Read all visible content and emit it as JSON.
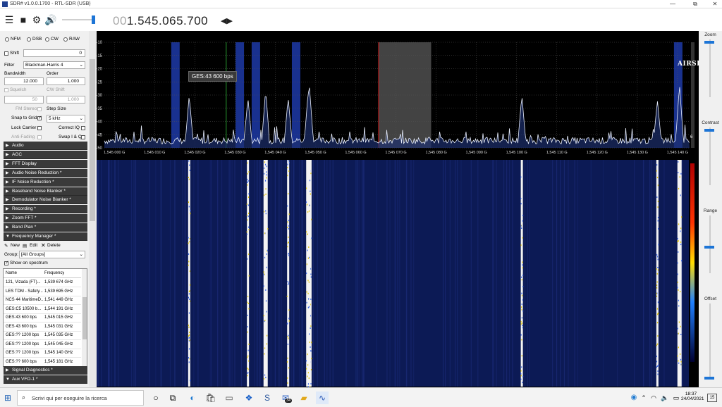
{
  "window": {
    "title": "SDR# v1.0.0.1700 - RTL-SDR (USB)",
    "buttons": [
      "—",
      "⧉",
      "✕"
    ]
  },
  "toolbar": {
    "frequency_dim": "00",
    "frequency": "1.545.065.700",
    "arrows": "◀▶",
    "logo": "AIRSPY"
  },
  "radio": {
    "modes": [
      "NFM",
      "DSB",
      "CW",
      "RAW"
    ],
    "shift_label": "Shift",
    "shift_value": "0",
    "filter_label": "Filter",
    "filter_value": "Blackman-Harris 4",
    "bandwidth_label": "Bandwidth",
    "bandwidth_value": "12.000",
    "order_label": "Order",
    "order_value": "1.000",
    "squelch_label": "Squelch",
    "squelch_value": "50",
    "cwshift_label": "CW Shift",
    "cwshift_value": "1.000",
    "fmstereo_label": "FM Stereo",
    "stepsize_label": "Step Size",
    "snap_label": "Snap to Grid",
    "step_value": "5 kHz",
    "lockcarrier_label": "Lock Carrier",
    "correctiq_label": "Correct IQ",
    "antifading_label": "Anti-Fading",
    "swapiq_label": "Swap I & Q"
  },
  "sections_top": [
    {
      "label": "Audio",
      "arrow": "▶"
    },
    {
      "label": "AGC",
      "arrow": "▶"
    },
    {
      "label": "FFT Display",
      "arrow": "▶"
    },
    {
      "label": "Audio Noise Reduction *",
      "arrow": "▶"
    },
    {
      "label": "IF Noise Reduction *",
      "arrow": "▶"
    },
    {
      "label": "Baseband Noise Blanker *",
      "arrow": "▶"
    },
    {
      "label": "Demodulator Noise Blanker *",
      "arrow": "▶"
    },
    {
      "label": "Recording *",
      "arrow": "▶"
    },
    {
      "label": "Zoom FFT *",
      "arrow": "▶"
    },
    {
      "label": "Band Plan *",
      "arrow": "▶"
    },
    {
      "label": "Frequency Manager *",
      "arrow": "▼"
    }
  ],
  "freqmanager": {
    "new_label": "New",
    "edit_label": "Edit",
    "delete_label": "Delete",
    "group_label": "Group:",
    "group_value": "[All Groups]",
    "show_on_spectrum": "Show on spectrum",
    "columns": [
      "Name",
      "Frequency"
    ],
    "rows": [
      [
        "121, Vizada (FT)...",
        "1,539 674 GHz"
      ],
      [
        "LES TDM - Safety...",
        "1,539 695 GHz"
      ],
      [
        "NCS 44 MaritimeD...",
        "1,541 449 GHz"
      ],
      [
        "GES:C5  10500 b...",
        "1,544 191 GHz"
      ],
      [
        "GES:43  600 bps",
        "1,545 015 GHz"
      ],
      [
        "GES 43 600 bps",
        "1,545 031 GHz"
      ],
      [
        "GES:??  1200 bps",
        "1,545 035 GHz"
      ],
      [
        "GES:??  1200 bps",
        "1,545 045 GHz"
      ],
      [
        "GES:??  1200 bps",
        "1,545 140 GHz"
      ],
      [
        "GES:??  600 bps",
        "1,545 181 GHz"
      ]
    ]
  },
  "sections_bottom": [
    {
      "label": "Signal Diagnostics *",
      "arrow": "▶"
    },
    {
      "label": "Aux VFO-1 *",
      "arrow": "▼"
    }
  ],
  "chart_data": {
    "type": "line",
    "yticks": [
      "-10",
      "-15",
      "-20",
      "-25",
      "-30",
      "-35",
      "-40",
      "-45",
      "-50"
    ],
    "ylim": [
      -50,
      -10
    ],
    "xticks": [
      "1,545 000 G",
      "1,545 010 G",
      "1,545 020 G",
      "1,545 030 G",
      "1,545 040 G",
      "1,545 050 G",
      "1,545 060 G",
      "1,545 070 G",
      "1,545 080 G",
      "1,545 090 G",
      "1,545 100 G",
      "1,545 110 G",
      "1,545 120 G",
      "1,545 130 G",
      "1,545 140 G"
    ],
    "xlim_mhz": [
      1544.9975,
      1545.143
    ],
    "tooltip": "GES:43  600 bps",
    "side_value": "6",
    "noise_floor_db": -48,
    "peaks": [
      {
        "freq": 1545.0186,
        "db": -30
      },
      {
        "freq": 1545.0332,
        "db": -31
      },
      {
        "freq": 1545.0376,
        "db": -28
      },
      {
        "freq": 1545.0432,
        "db": -31
      },
      {
        "freq": 1545.0485,
        "db": -27
      },
      {
        "freq": 1545.0482,
        "db": -28
      },
      {
        "freq": 1545.1013,
        "db": -30
      },
      {
        "freq": 1545.135,
        "db": -32
      },
      {
        "freq": 1545.1405,
        "db": -26
      }
    ],
    "markers_mhz": [
      1545.015,
      1545.031,
      1545.035,
      1545.045,
      1545.14
    ],
    "vfo_mhz": 1545.0657,
    "filter_band_mhz": [
      1545.0657,
      1545.0777
    ]
  },
  "rightpanel": {
    "labels": [
      "Zoom",
      "Contrast",
      "Range",
      "Offset"
    ],
    "levels": [
      0.95,
      0.95,
      0.45,
      0.02
    ]
  },
  "taskbar": {
    "search_placeholder": "Scrivi qui per eseguire la ricerca",
    "time": "18:37",
    "date": "24/04/2021",
    "notif_count": "15",
    "badge": "34"
  },
  "colors": {
    "spectrum_bg": "#000000",
    "waterfall_bg": "#0c1a55",
    "marker_band": "#1d3aa8",
    "accent": "#1d75d6",
    "section_bg": "#3a3a3a"
  }
}
